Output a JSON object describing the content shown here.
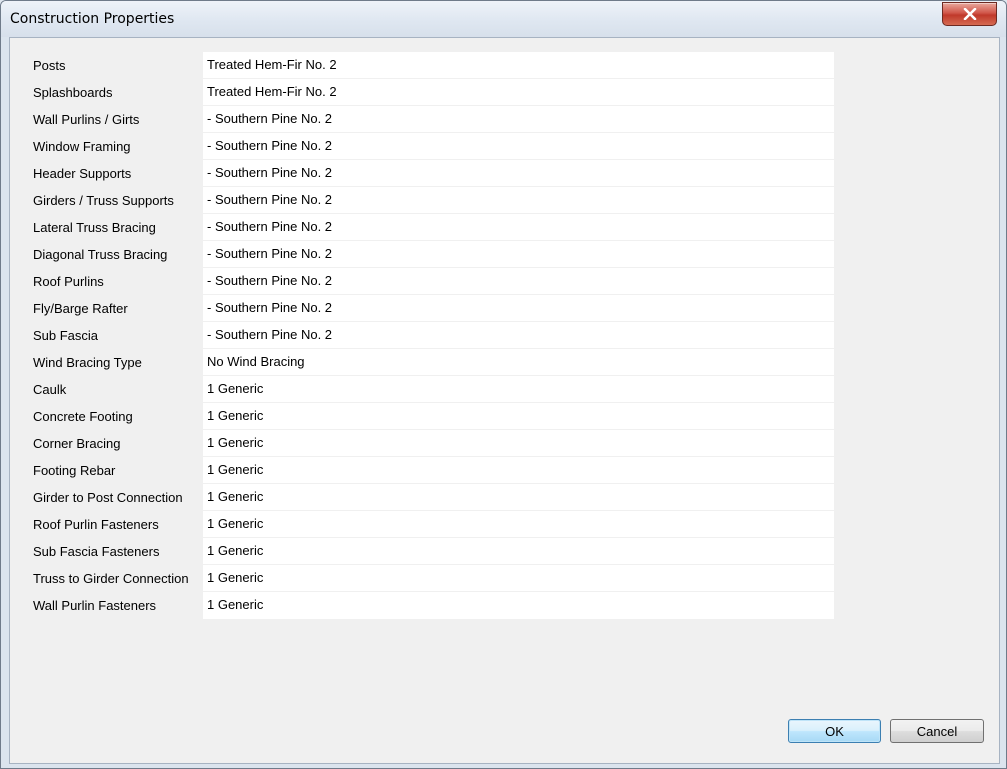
{
  "window": {
    "title": "Construction Properties"
  },
  "properties": [
    {
      "label": "Posts",
      "value": "Treated Hem-Fir No. 2"
    },
    {
      "label": "Splashboards",
      "value": "Treated Hem-Fir No. 2"
    },
    {
      "label": "Wall Purlins / Girts",
      "value": "- Southern Pine No. 2"
    },
    {
      "label": "Window Framing",
      "value": "- Southern Pine No. 2"
    },
    {
      "label": "Header Supports",
      "value": "- Southern Pine No. 2"
    },
    {
      "label": "Girders / Truss Supports",
      "value": "- Southern Pine No. 2"
    },
    {
      "label": "Lateral Truss Bracing",
      "value": "- Southern Pine No. 2"
    },
    {
      "label": "Diagonal Truss Bracing",
      "value": "- Southern Pine No. 2"
    },
    {
      "label": "Roof Purlins",
      "value": "- Southern Pine No. 2"
    },
    {
      "label": "Fly/Barge Rafter",
      "value": "- Southern Pine No. 2"
    },
    {
      "label": "Sub Fascia",
      "value": "- Southern Pine No. 2"
    },
    {
      "label": "Wind Bracing Type",
      "value": "No Wind Bracing"
    },
    {
      "label": "Caulk",
      "value": "1 Generic"
    },
    {
      "label": "Concrete Footing",
      "value": "1 Generic"
    },
    {
      "label": "Corner Bracing",
      "value": "1 Generic"
    },
    {
      "label": "Footing Rebar",
      "value": "1 Generic"
    },
    {
      "label": "Girder to Post Connection",
      "value": "1 Generic"
    },
    {
      "label": "Roof Purlin Fasteners",
      "value": "1 Generic"
    },
    {
      "label": "Sub Fascia Fasteners",
      "value": "1 Generic"
    },
    {
      "label": "Truss to Girder Connection",
      "value": "1 Generic"
    },
    {
      "label": "Wall Purlin Fasteners",
      "value": "1 Generic"
    }
  ],
  "buttons": {
    "ok_label": "OK",
    "cancel_label": "Cancel"
  },
  "icons": {
    "close": "close-icon"
  },
  "colors": {
    "close_button": "#c0392b",
    "ok_border": "#3c7fb1"
  }
}
